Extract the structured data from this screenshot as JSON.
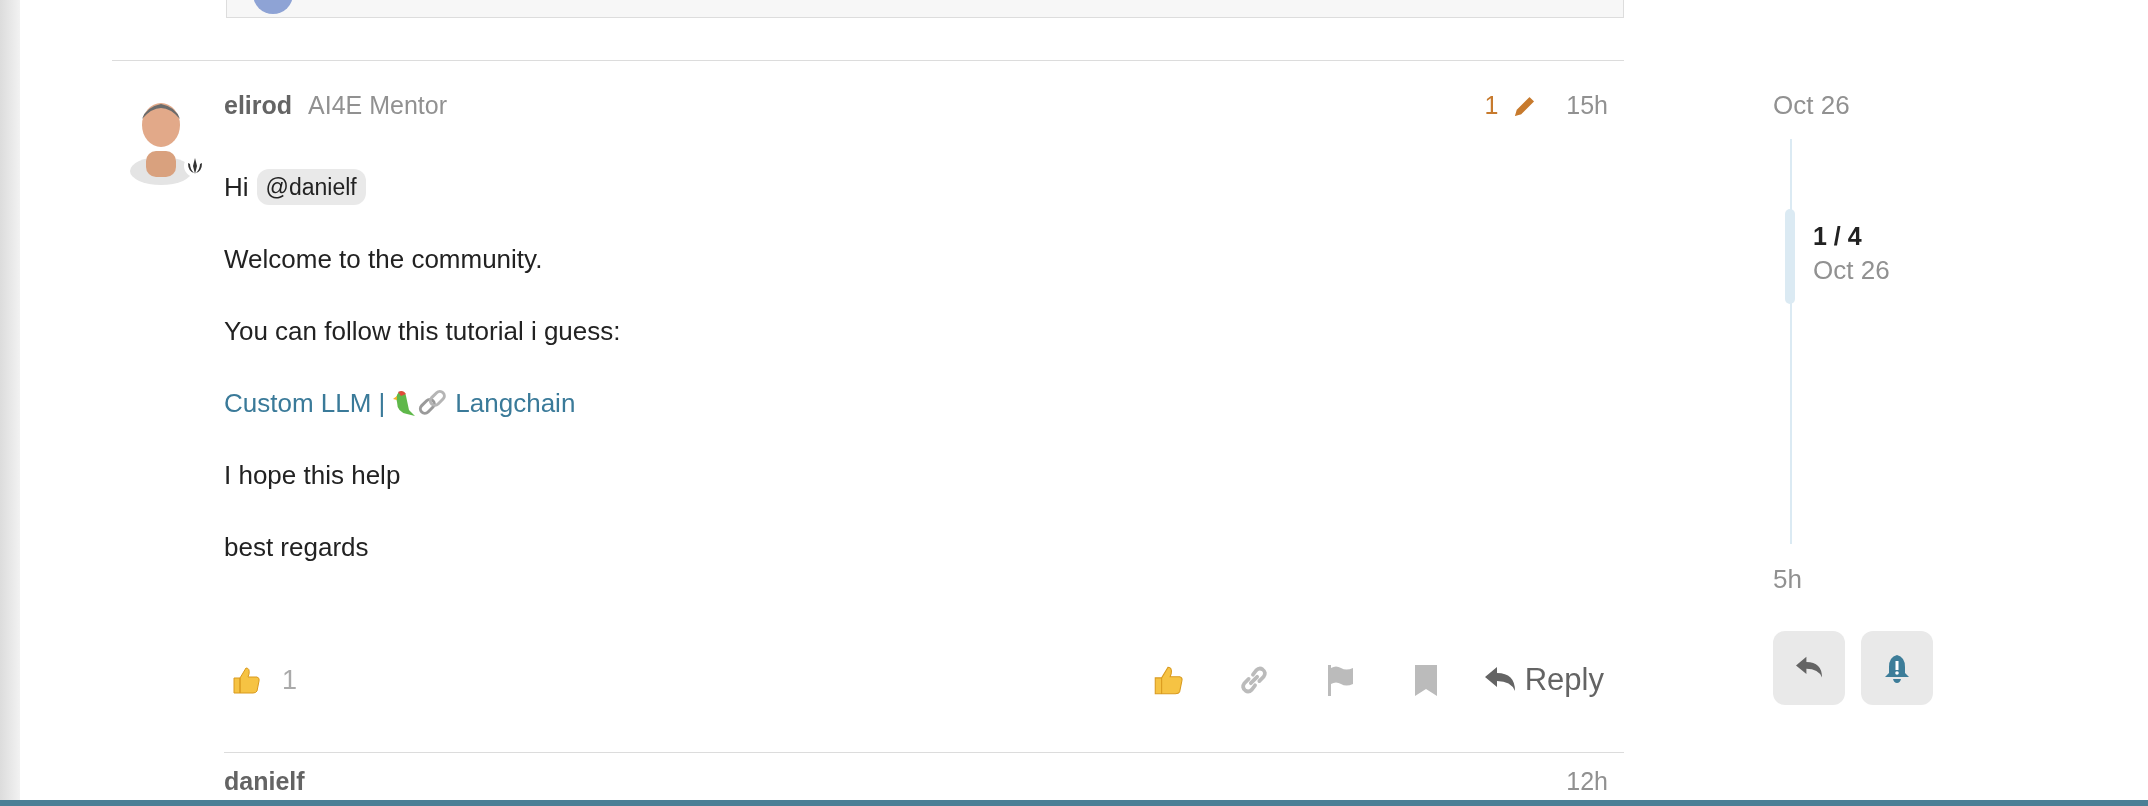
{
  "post": {
    "username": "elirod",
    "user_title": "AI4E Mentor",
    "edit_count": "1",
    "time": "15h",
    "body": [
      {
        "kind": "greeting",
        "text": "Hi",
        "mention": "@danielf"
      },
      {
        "kind": "text",
        "text": "Welcome to the community."
      },
      {
        "kind": "text",
        "text": "You can follow this tutorial i guess:"
      },
      {
        "kind": "link",
        "before": "Custom LLM |",
        "after": "Langchain"
      },
      {
        "kind": "text",
        "text": "I hope this help"
      },
      {
        "kind": "text",
        "text": "best regards"
      }
    ],
    "reaction_count": "1",
    "reply_label": "Reply"
  },
  "timeline": {
    "start": "Oct 26",
    "position": "1 / 4",
    "position_date": "Oct 26",
    "end": "5h"
  },
  "next_post": {
    "username": "danielf",
    "time": "12h"
  }
}
